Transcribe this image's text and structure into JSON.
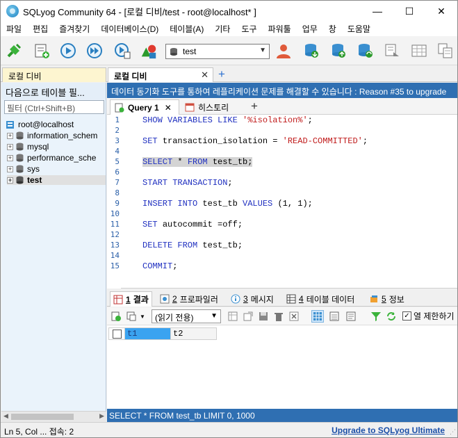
{
  "window": {
    "title": "SQLyog Community 64 - [로컬 디비/test - root@localhost* ]",
    "minimize": "—",
    "maximize": "☐",
    "close": "✕"
  },
  "menu": [
    "파일",
    "편집",
    "즐겨찾기",
    "데이터베이스(D)",
    "테이블(A)",
    "기타",
    "도구",
    "파워툴",
    "업무",
    "창",
    "도움말"
  ],
  "toolbar": {
    "database_select": "test",
    "icons": [
      "new-connection-icon",
      "new-query-icon",
      "execute-query-icon",
      "execute-all-icon",
      "execute-edit-icon",
      "schema-designer-icon",
      "user-manager-icon",
      "backup-icon",
      "restore-icon",
      "import-icon",
      "sync-icon",
      "table-icon",
      "query-builder-icon"
    ]
  },
  "connection_tabs": {
    "inactive": "로컬 디비",
    "active": "로컬 디비",
    "close": "✕",
    "add": "+"
  },
  "left_panel": {
    "header": "다음으로 테이블 필...",
    "filter_placeholder": "필터 (Ctrl+Shift+B)",
    "root": "root@localhost",
    "databases": [
      "information_schem",
      "mysql",
      "performance_sche",
      "sys",
      "test"
    ],
    "selected_database": "test"
  },
  "info_bar": "데이터 동기화 도구를 통하여 레플리케이션 문제를 해결할 수 있습니다 : Reason #35 to upgrade",
  "query_tabs": {
    "active": "Query 1",
    "close": "✕",
    "history": "히스토리",
    "add": "+"
  },
  "editor": {
    "line_numbers": [
      "1",
      "2",
      "3",
      "4",
      "5",
      "6",
      "7",
      "8",
      "9",
      "10",
      "11",
      "12",
      "13",
      "14",
      "15"
    ],
    "lines": [
      {
        "n": 1,
        "parts": [
          [
            "kw",
            "SHOW VARIABLES LIKE "
          ],
          [
            "str",
            "'%isolation%'"
          ],
          [
            "plain",
            ";"
          ]
        ]
      },
      {
        "n": 3,
        "parts": [
          [
            "kw",
            "SET "
          ],
          [
            "plain",
            "transaction_isolation = "
          ],
          [
            "str",
            "'READ-COMMITTED'"
          ],
          [
            "plain",
            ";"
          ]
        ]
      },
      {
        "n": 5,
        "parts": [
          [
            "kw",
            "SELECT "
          ],
          [
            "plain",
            "* "
          ],
          [
            "kw",
            "FROM "
          ],
          [
            "plain",
            "test_tb;"
          ]
        ],
        "highlight": true
      },
      {
        "n": 7,
        "parts": [
          [
            "kw",
            "START TRANSACTION"
          ],
          [
            "plain",
            ";"
          ]
        ]
      },
      {
        "n": 9,
        "parts": [
          [
            "kw",
            "INSERT INTO "
          ],
          [
            "plain",
            "test_tb "
          ],
          [
            "kw",
            "VALUES "
          ],
          [
            "plain",
            "(1, 1);"
          ]
        ]
      },
      {
        "n": 11,
        "parts": [
          [
            "kw",
            "SET "
          ],
          [
            "plain",
            "autocommit =off;"
          ]
        ]
      },
      {
        "n": 13,
        "parts": [
          [
            "kw",
            "DELETE FROM "
          ],
          [
            "plain",
            "test_tb;"
          ]
        ]
      },
      {
        "n": 15,
        "parts": [
          [
            "kw",
            "COMMIT"
          ],
          [
            "plain",
            ";"
          ]
        ]
      }
    ]
  },
  "result_tabs": [
    {
      "num": "1",
      "label": "결과"
    },
    {
      "num": "2",
      "label": "프로파일러"
    },
    {
      "num": "3",
      "label": "메시지"
    },
    {
      "num": "4",
      "label": "테이블 데이터"
    },
    {
      "num": "5",
      "label": "정보"
    }
  ],
  "result_toolbar": {
    "mode_select": "(읽기 전용)",
    "limit_label": "열 제한하기",
    "limit_checked": true
  },
  "grid": {
    "columns": [
      "t1",
      "t2"
    ]
  },
  "query_status": "SELECT * FROM test_tb LIMIT 0, 1000",
  "status_bar": {
    "left": "Ln 5, Col ... 접속: 2",
    "upgrade_link": "Upgrade to SQLyog Ultimate"
  },
  "colors": {
    "accent_blue": "#2f6fb2",
    "keyword": "#2030c0",
    "string": "#c01a1a",
    "line_number": "#2a5fa8"
  }
}
